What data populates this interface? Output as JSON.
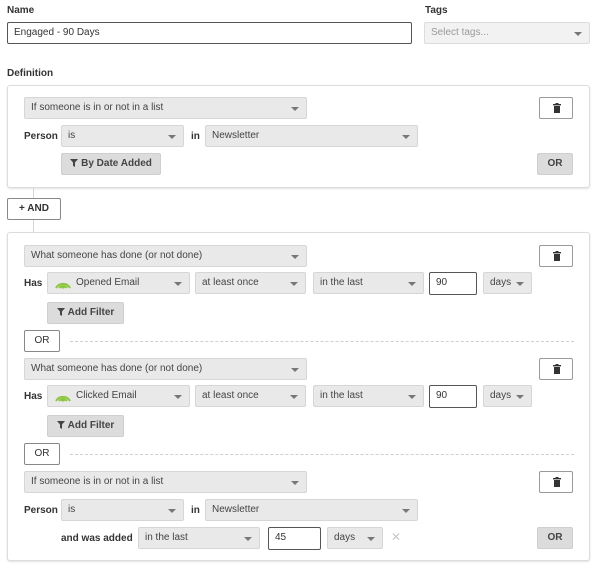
{
  "header": {
    "name_label": "Name",
    "name_value": "Engaged - 90 Days",
    "tags_label": "Tags",
    "tags_placeholder": "Select tags..."
  },
  "definition_label": "Definition",
  "group1": {
    "condition_type": "If someone is in or not in a list",
    "person_label": "Person",
    "is_select": "is",
    "in_label": "in",
    "list_select": "Newsletter",
    "by_date_added_label": "By Date Added",
    "or_label": "OR"
  },
  "and_label": "AND",
  "group2": {
    "row1": {
      "condition_type": "What someone has done (or not done)",
      "has_label": "Has",
      "metric": "Opened Email",
      "frequency": "at least once",
      "timeframe": "in the last",
      "amount": "90",
      "unit": "days",
      "add_filter_label": "Add Filter"
    },
    "or_divider_1": "OR",
    "row2": {
      "condition_type": "What someone has done (or not done)",
      "has_label": "Has",
      "metric": "Clicked Email",
      "frequency": "at least once",
      "timeframe": "in the last",
      "amount": "90",
      "unit": "days",
      "add_filter_label": "Add Filter"
    },
    "or_divider_2": "OR",
    "row3": {
      "condition_type": "If someone is in or not in a list",
      "person_label": "Person",
      "is_select": "is",
      "in_label": "in",
      "list_select": "Newsletter",
      "added_label": "and was added",
      "added_timeframe": "in the last",
      "added_amount": "45",
      "added_unit": "days",
      "or_label": "OR"
    }
  },
  "colors": {
    "email_icon_green": "#8cc63f"
  }
}
